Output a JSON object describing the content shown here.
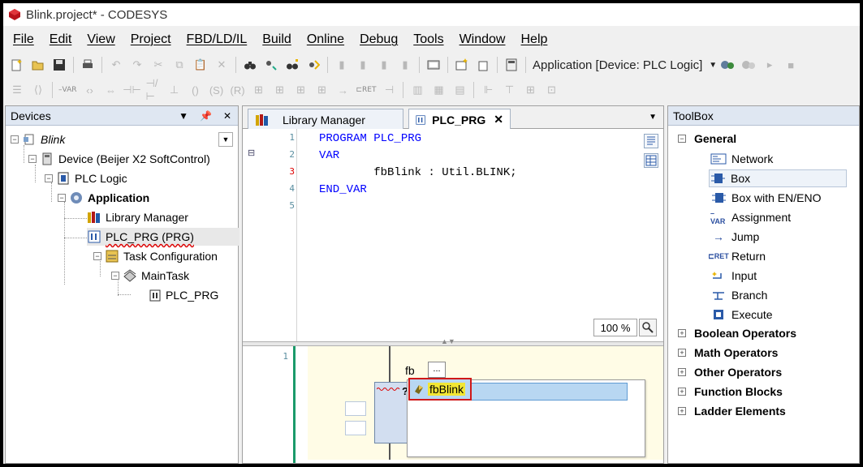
{
  "window": {
    "title": "Blink.project* - CODESYS"
  },
  "menu": [
    "File",
    "Edit",
    "View",
    "Project",
    "FBD/LD/IL",
    "Build",
    "Online",
    "Debug",
    "Tools",
    "Window",
    "Help"
  ],
  "toolbar": {
    "application_selector": "Application [Device: PLC Logic]"
  },
  "devices": {
    "title": "Devices",
    "nodes": [
      {
        "label": "Blink"
      },
      {
        "label": "Device (Beijer X2 SoftControl)"
      },
      {
        "label": "PLC Logic"
      },
      {
        "label": "Application"
      },
      {
        "label": "Library Manager"
      },
      {
        "label": "PLC_PRG (PRG)"
      },
      {
        "label": "Task Configuration"
      },
      {
        "label": "MainTask"
      },
      {
        "label": "PLC_PRG"
      }
    ]
  },
  "editor": {
    "tabs": [
      {
        "label": "Library Manager"
      },
      {
        "label": "PLC_PRG"
      }
    ],
    "decl_lines": [
      {
        "num": "1",
        "text": "PROGRAM PLC_PRG"
      },
      {
        "num": "2",
        "text": "VAR"
      },
      {
        "num": "3",
        "text": "        fbBlink : Util.BLINK;"
      },
      {
        "num": "4",
        "text": "END_VAR"
      },
      {
        "num": "5",
        "text": ""
      }
    ],
    "zoom": "100 %",
    "network_number": "1",
    "fb_instance_label": "fb",
    "fb_button_label": "...",
    "fb_box_unknown": "?",
    "autocomplete_item": "fbBlink"
  },
  "toolbox": {
    "title": "ToolBox",
    "categories": [
      {
        "label": "General",
        "expanded": true
      },
      {
        "label": "Boolean Operators"
      },
      {
        "label": "Math Operators"
      },
      {
        "label": "Other Operators"
      },
      {
        "label": "Function Blocks"
      },
      {
        "label": "Ladder Elements"
      }
    ],
    "general_items": [
      "Network",
      "Box",
      "Box with EN/ENO",
      "Assignment",
      "Jump",
      "Return",
      "Input",
      "Branch",
      "Execute"
    ]
  },
  "colors": {
    "keyword": "#0000ff",
    "panel_header": "#dfe7f2",
    "network_bg": "#fffce6",
    "selection": "#b8d7f2",
    "highlight_border": "#d01818"
  }
}
